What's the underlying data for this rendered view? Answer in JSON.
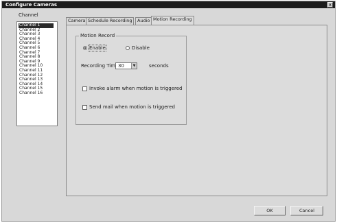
{
  "window": {
    "title": "Configure Cameras",
    "close_label": "x"
  },
  "channel_panel": {
    "label": "Channel",
    "items": [
      "Channel 1",
      "Channel 2",
      "Channel 3",
      "Channel 4",
      "Channel 5",
      "Channel 6",
      "Channel 7",
      "Channel 8",
      "Channel 9",
      "Channel 10",
      "Channel 11",
      "Channel 12",
      "Channel 13",
      "Channel 14",
      "Channel 15",
      "Channel 16"
    ],
    "selected": "Channel 1"
  },
  "tabs": [
    "Camera",
    "Schedule Recording",
    "Audio",
    "Motion Recording"
  ],
  "active_tab": "Motion Recording",
  "motion": {
    "group_title": "Motion Record",
    "enable_label": "Enable",
    "disable_label": "Disable",
    "selected": "Enable",
    "recording_time_label": "Recording Time",
    "recording_time_value": "30",
    "seconds_label": "seconds",
    "invoke_alarm_label": "Invoke alarm when motion is triggered",
    "invoke_alarm_checked": false,
    "send_mail_label": "Send mail when motion is triggered",
    "send_mail_checked": false
  },
  "buttons": {
    "ok": "OK",
    "cancel": "Cancel"
  },
  "colors": {
    "titlebar": "#1c1c1c",
    "selection": "#2a2a2a",
    "face": "#d8d8d8"
  }
}
